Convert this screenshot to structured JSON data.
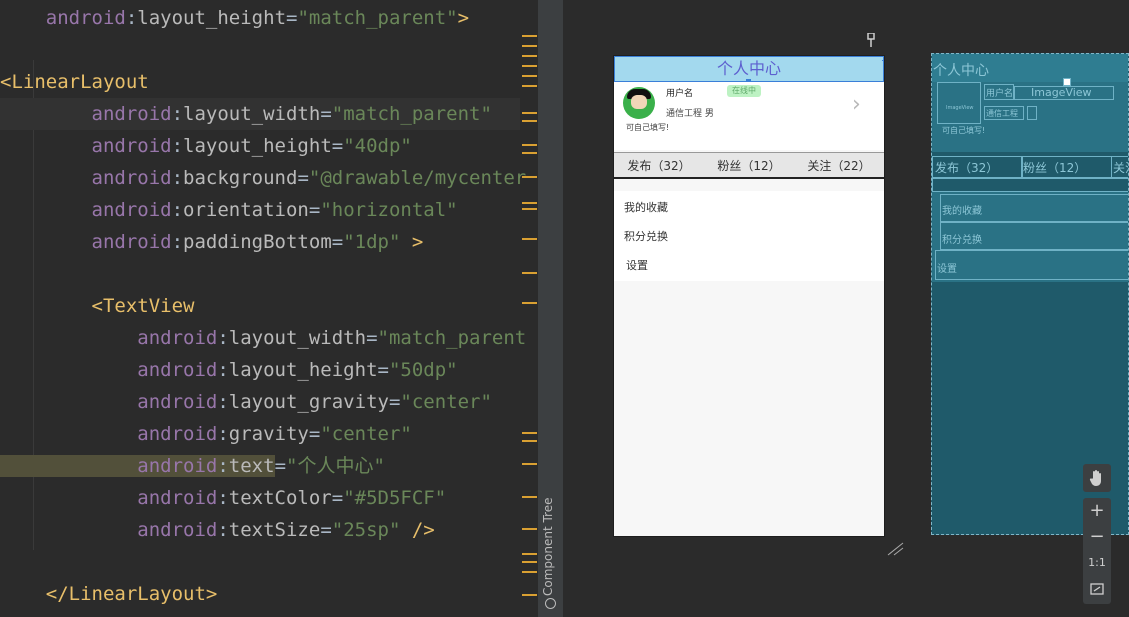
{
  "editor": {
    "lines": [
      {
        "parts": [
          [
            "ns",
            "    android"
          ],
          [
            "eq",
            ":"
          ],
          [
            "attr",
            "layout_height"
          ],
          [
            "eq",
            "="
          ],
          [
            "val",
            "\"match_parent\""
          ],
          [
            "punct",
            ">"
          ]
        ]
      },
      {
        "parts": []
      },
      {
        "parts": [
          [
            "brk",
            "<"
          ],
          [
            "tag",
            "LinearLayout"
          ]
        ]
      },
      {
        "parts": [
          [
            "ns",
            "        android"
          ],
          [
            "eq",
            ":"
          ],
          [
            "attr",
            "layout_width"
          ],
          [
            "eq",
            "="
          ],
          [
            "val",
            "\"match_parent\""
          ]
        ],
        "caret": true
      },
      {
        "parts": [
          [
            "ns",
            "        android"
          ],
          [
            "eq",
            ":"
          ],
          [
            "attr",
            "layout_height"
          ],
          [
            "eq",
            "="
          ],
          [
            "val",
            "\"40dp\""
          ]
        ]
      },
      {
        "parts": [
          [
            "ns",
            "        android"
          ],
          [
            "eq",
            ":"
          ],
          [
            "attr",
            "background"
          ],
          [
            "eq",
            "="
          ],
          [
            "val",
            "\"@drawable/mycenter"
          ]
        ]
      },
      {
        "parts": [
          [
            "ns",
            "        android"
          ],
          [
            "eq",
            ":"
          ],
          [
            "attr",
            "orientation"
          ],
          [
            "eq",
            "="
          ],
          [
            "val",
            "\"horizontal\""
          ]
        ]
      },
      {
        "parts": [
          [
            "ns",
            "        android"
          ],
          [
            "eq",
            ":"
          ],
          [
            "attr",
            "paddingBottom"
          ],
          [
            "eq",
            "="
          ],
          [
            "val",
            "\"1dp\""
          ],
          [
            "punct",
            " >"
          ]
        ]
      },
      {
        "parts": []
      },
      {
        "parts": [
          [
            "brk",
            "        <"
          ],
          [
            "tag",
            "TextView"
          ]
        ]
      },
      {
        "parts": [
          [
            "ns",
            "            android"
          ],
          [
            "eq",
            ":"
          ],
          [
            "attr",
            "layout_width"
          ],
          [
            "eq",
            "="
          ],
          [
            "val",
            "\"match_parent"
          ]
        ]
      },
      {
        "parts": [
          [
            "ns",
            "            android"
          ],
          [
            "eq",
            ":"
          ],
          [
            "attr",
            "layout_height"
          ],
          [
            "eq",
            "="
          ],
          [
            "val",
            "\"50dp\""
          ]
        ]
      },
      {
        "parts": [
          [
            "ns",
            "            android"
          ],
          [
            "eq",
            ":"
          ],
          [
            "attr",
            "layout_gravity"
          ],
          [
            "eq",
            "="
          ],
          [
            "val",
            "\"center\""
          ]
        ]
      },
      {
        "parts": [
          [
            "ns",
            "            android"
          ],
          [
            "eq",
            ":"
          ],
          [
            "attr",
            "gravity"
          ],
          [
            "eq",
            "="
          ],
          [
            "val",
            "\"center\""
          ]
        ]
      },
      {
        "parts": [
          [
            "ns",
            "            android"
          ],
          [
            "eq",
            ":"
          ],
          [
            "attr",
            "text"
          ],
          [
            "eq",
            "="
          ],
          [
            "val",
            "\"个人中心\""
          ]
        ],
        "highlight": true
      },
      {
        "parts": [
          [
            "ns",
            "            android"
          ],
          [
            "eq",
            ":"
          ],
          [
            "attr",
            "textColor"
          ],
          [
            "eq",
            "="
          ],
          [
            "val",
            "\"#5D5FCF\""
          ]
        ]
      },
      {
        "parts": [
          [
            "ns",
            "            android"
          ],
          [
            "eq",
            ":"
          ],
          [
            "attr",
            "textSize"
          ],
          [
            "eq",
            "="
          ],
          [
            "val",
            "\"25sp\""
          ],
          [
            "punct",
            " />"
          ]
        ]
      },
      {
        "parts": []
      },
      {
        "parts": [
          [
            "brk",
            "    </"
          ],
          [
            "tag",
            "LinearLayout"
          ],
          [
            "brk",
            ">"
          ]
        ]
      }
    ]
  },
  "component_tree": {
    "label": "Component Tree"
  },
  "design": {
    "title": "个人中心",
    "username": "用户名",
    "badge": "在线中",
    "school": "通信工程  男",
    "signature": "可自己填写!",
    "stats": [
      "发布（32）",
      "粉丝（12）",
      "关注（22）"
    ],
    "menu": [
      "我的收藏",
      "积分兑换",
      "设置"
    ]
  },
  "blueprint": {
    "title": "个人中心",
    "username": "用户名",
    "image_label": "ImageView",
    "small_image_label": "ImageView",
    "school": "通信工程",
    "signature": "可自己填写!",
    "stats": [
      "发布（32）",
      "粉丝（12）",
      "关注"
    ],
    "menu": [
      "我的收藏",
      "积分兑换",
      "设置"
    ]
  },
  "zoom": {
    "zoom_in": "+",
    "zoom_out": "−",
    "one_to_one": "1:1"
  },
  "colors": {
    "accent": "#5d5fcf",
    "title_bg": "#a3d9ee",
    "blueprint_bg": "#1f5a6a"
  }
}
